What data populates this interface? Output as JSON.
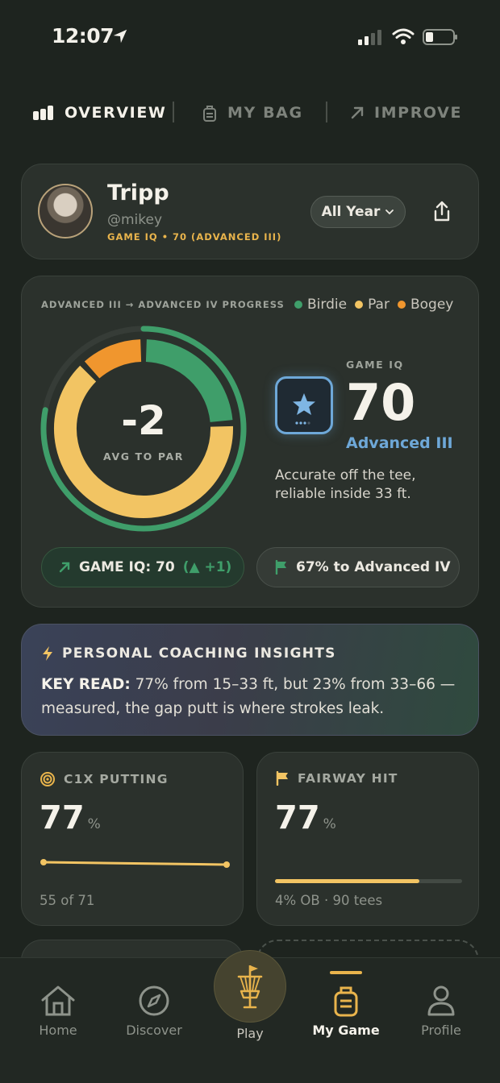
{
  "status_bar": {
    "time": "12:07"
  },
  "tabs": [
    {
      "label": "OVERVIEW",
      "icon": "bar-chart-icon",
      "active": true
    },
    {
      "label": "MY BAG",
      "icon": "bag-icon",
      "active": false
    },
    {
      "label": "IMPROVE",
      "icon": "arrow-up-right-icon",
      "active": false
    }
  ],
  "profile": {
    "name": "Tripp",
    "handle": "@mikey",
    "game_iq_line": "GAME IQ • 70 (ADVANCED III)",
    "period": "All Year"
  },
  "progress": {
    "title": "ADVANCED III → ADVANCED IV PROGRESS",
    "legend": [
      {
        "label": "Birdie",
        "color": "#3f9e6a"
      },
      {
        "label": "Par",
        "color": "#f2c463"
      },
      {
        "label": "Bogey",
        "color": "#f0962e"
      }
    ],
    "avg_to_par_value": "-2",
    "avg_to_par_label": "AVG TO PAR",
    "ring": {
      "birdie": 0.24,
      "par": 0.64,
      "bogey": 0.12,
      "outer_progress": 0.78
    },
    "game_iq_label": "GAME IQ",
    "game_iq_value": "70",
    "tier": "Advanced III",
    "description": "Accurate off the tee, reliable inside 33 ft.",
    "pill_left_label": "GAME IQ: 70",
    "pill_left_delta": "(▲ +1)",
    "pill_right_label": "67% to Advanced IV"
  },
  "coaching": {
    "title": "PERSONAL COACHING INSIGHTS",
    "key_label": "KEY READ:",
    "body": "77% from 15–33 ft, but 23% from 33–66 — measured, the gap putt is where strokes leak."
  },
  "stats": {
    "putting": {
      "title": "C1X PUTTING",
      "value": "77",
      "unit": "%",
      "footer": "55 of 71",
      "trend": [
        0.78,
        0.77
      ]
    },
    "fairway": {
      "title": "FAIRWAY HIT",
      "value": "77",
      "unit": "%",
      "footer": "4% OB · 90 tees",
      "fill": 0.77
    }
  },
  "nav": [
    {
      "label": "Home",
      "icon": "home-icon"
    },
    {
      "label": "Discover",
      "icon": "compass-icon"
    },
    {
      "label": "Play",
      "icon": "disc-basket-icon"
    },
    {
      "label": "My Game",
      "icon": "bag-icon",
      "active": true
    },
    {
      "label": "Profile",
      "icon": "person-icon"
    }
  ],
  "colors": {
    "birdie": "#3f9e6a",
    "par": "#f2c463",
    "bogey": "#f0962e",
    "accent": "#e9b44c",
    "tier": "#6ea8d8"
  }
}
